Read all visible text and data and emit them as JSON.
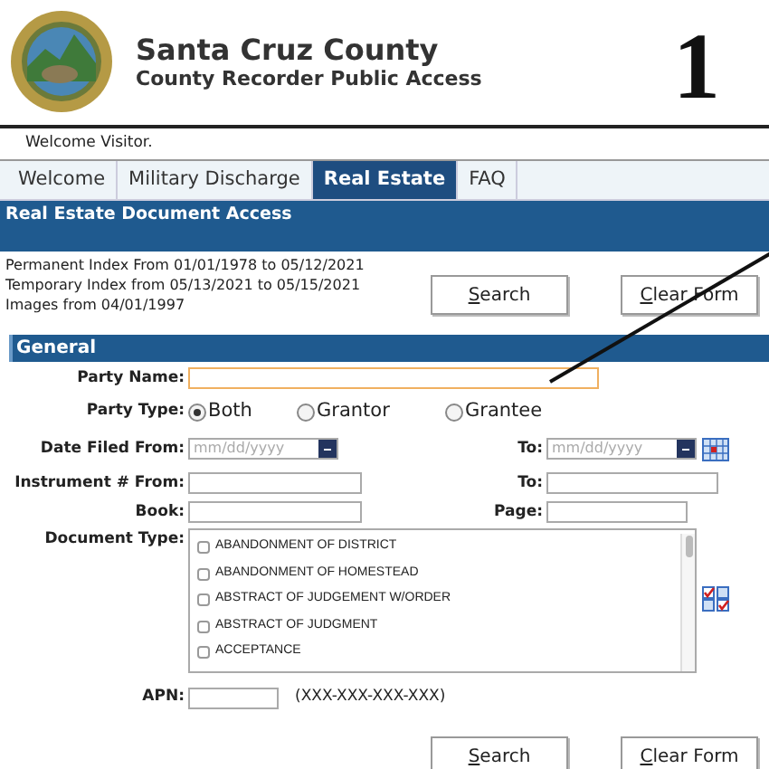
{
  "header": {
    "title": "Santa Cruz County",
    "subtitle": "County Recorder Public Access",
    "annotation_number": "1"
  },
  "welcome": "Welcome Visitor.",
  "tabs": [
    {
      "label": "Welcome",
      "selected": false
    },
    {
      "label": "Military Discharge",
      "selected": false
    },
    {
      "label": "Real Estate",
      "selected": true
    },
    {
      "label": "FAQ",
      "selected": false
    }
  ],
  "section_title": "Real Estate Document Access",
  "index_info": [
    "Permanent Index From 01/01/1978 to 05/12/2021",
    "Temporary Index from 05/13/2021 to 05/15/2021",
    "Images from 04/01/1997"
  ],
  "top_buttons": [
    "Search",
    "Clear Form"
  ],
  "general": {
    "title": "General",
    "party_name": {
      "label": "Party Name:"
    },
    "party_type": {
      "label": "Party Type:",
      "options": [
        {
          "label": "Both",
          "selected": true
        },
        {
          "label": "Grantor",
          "selected": false
        },
        {
          "label": "Grantee",
          "selected": false
        }
      ]
    },
    "date_filed": {
      "label": "Date Filed From:",
      "from_placeholder": "mm/dd/yyyy",
      "to_label": "To:",
      "to_placeholder": "mm/dd/yyyy"
    },
    "instrument": {
      "label": "Instrument # From:",
      "to_label": "To:"
    },
    "book": {
      "label": "Book:"
    },
    "page": {
      "label": "Page:"
    },
    "document_type": {
      "label": "Document Type:",
      "items": [
        {
          "label": "ABANDONMENT OF DISTRICT",
          "checked": false
        },
        {
          "label": "ABANDONMENT OF HOMESTEAD",
          "checked": false
        },
        {
          "label": "ABSTRACT OF JUDGEMENT W/ORDER",
          "checked": false
        },
        {
          "label": "ABSTRACT OF JUDGMENT",
          "checked": false
        },
        {
          "label": "ACCEPTANCE",
          "checked": false
        }
      ]
    },
    "apn": {
      "label": "APN:",
      "hint": "(XXX-XXX-XXX-XXX)"
    }
  },
  "bottom_buttons": [
    "Search",
    "Clear Form"
  ]
}
